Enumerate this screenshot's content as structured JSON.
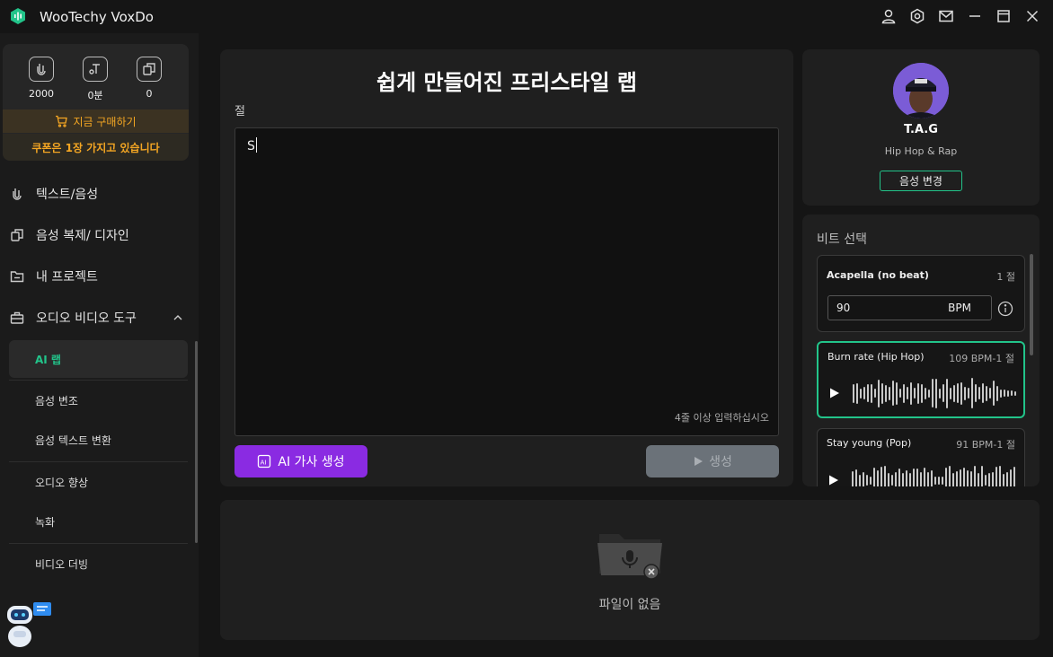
{
  "app": {
    "title": "WooTechy VoxDo"
  },
  "stats": [
    {
      "icon": "voice-clip-icon",
      "value": "2000"
    },
    {
      "icon": "text-voice-icon",
      "value": "0분"
    },
    {
      "icon": "voice-clone-icon",
      "value": "0"
    }
  ],
  "buy": {
    "label": "지금 구매하기"
  },
  "coupon": {
    "label": "쿠폰은 1장 가지고 있습니다"
  },
  "nav": {
    "text_voice": "텍스트/음성",
    "clone_design": "음성 복제/ 디자인",
    "my_projects": "내 프로젝트",
    "av_tools": "오디오 비디오 도구"
  },
  "subnav": {
    "ai_rap": "AI 랩",
    "voice_changer": "음성 변조",
    "speech_to_text": "음성 텍스트 변환",
    "audio_enhance": "오디오 향상",
    "recording": "녹화",
    "video_dubbing": "비디오 더빙"
  },
  "editor": {
    "title": "쉽게 만들어진 프리스타일 랩",
    "verse_label": "절",
    "lyrics": "S",
    "hint": "4줄 이상 입력하십시오",
    "ai_button": "AI 가사 생성",
    "generate_button": "생성"
  },
  "artist": {
    "name": "T.A.G",
    "genre": "Hip Hop & Rap",
    "change_button": "음성 변경"
  },
  "beats": {
    "title": "비트 선택",
    "items": [
      {
        "name": "Acapella (no beat)",
        "meta": "1 절",
        "bpm_value": "90",
        "bpm_unit": "BPM"
      },
      {
        "name": "Burn rate (Hip Hop)",
        "meta": "109 BPM-1 절"
      },
      {
        "name": "Stay young (Pop)",
        "meta": "91 BPM-1 절"
      }
    ]
  },
  "files": {
    "empty_label": "파일이 없음"
  },
  "colors": {
    "accent_green": "#22c48a",
    "accent_purple": "#8a2be2",
    "warning_orange": "#f4a623"
  }
}
